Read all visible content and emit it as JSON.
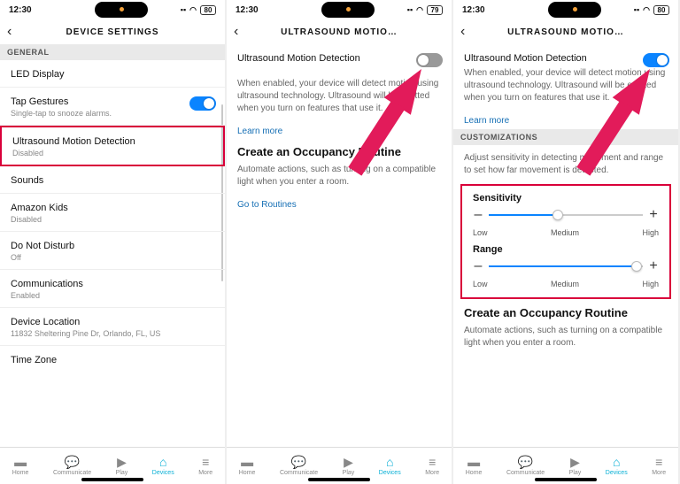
{
  "status": {
    "time": "12:30",
    "signal": "␡",
    "wifi": "⋮",
    "batt1": "80",
    "batt2": "79",
    "batt3": "80"
  },
  "screen1": {
    "title": "DEVICE SETTINGS",
    "section": "GENERAL",
    "rows": {
      "led": {
        "title": "LED Display"
      },
      "tap": {
        "title": "Tap Gestures",
        "sub": "Single-tap to snooze alarms."
      },
      "umd": {
        "title": "Ultrasound Motion Detection",
        "sub": "Disabled"
      },
      "sounds": {
        "title": "Sounds"
      },
      "kids": {
        "title": "Amazon Kids",
        "sub": "Disabled"
      },
      "dnd": {
        "title": "Do Not Disturb",
        "sub": "Off"
      },
      "comm": {
        "title": "Communications",
        "sub": "Enabled"
      },
      "loc": {
        "title": "Device Location",
        "sub": "11832 Sheltering Pine Dr, Orlando, FL, US"
      },
      "tz": {
        "title": "Time Zone"
      }
    }
  },
  "screen2": {
    "title": "ULTRASOUND MOTIO…",
    "toggleLabel": "Ultrasound Motion Detection",
    "desc": "When enabled, your device will detect motion using ultrasound technology. Ultrasound will be emitted when you turn on features that use it.",
    "learn": "Learn more",
    "routineTitle": "Create an Occupancy Routine",
    "routineDesc": "Automate actions, such as turning on a compatible light when you enter a room.",
    "goto": "Go to Routines"
  },
  "screen3": {
    "title": "ULTRASOUND MOTIO…",
    "toggleLabel": "Ultrasound Motion Detection",
    "desc": "When enabled, your device will detect motion using ultrasound technology. Ultrasound will be emitted when you turn on features that use it.",
    "learn": "Learn more",
    "customizations": "CUSTOMIZATIONS",
    "adjust": "Adjust sensitivity in detecting movement and range to set how far movement is detected.",
    "sensitivity": {
      "label": "Sensitivity",
      "low": "Low",
      "med": "Medium",
      "high": "High",
      "pct": 45
    },
    "range": {
      "label": "Range",
      "low": "Low",
      "med": "Medium",
      "high": "High",
      "pct": 96
    },
    "routineTitle": "Create an Occupancy Routine",
    "routineDesc": "Automate actions, such as turning on a compatible light when you enter a room."
  },
  "tabs": {
    "home": "Home",
    "comm": "Communicate",
    "play": "Play",
    "devices": "Devices",
    "more": "More"
  }
}
